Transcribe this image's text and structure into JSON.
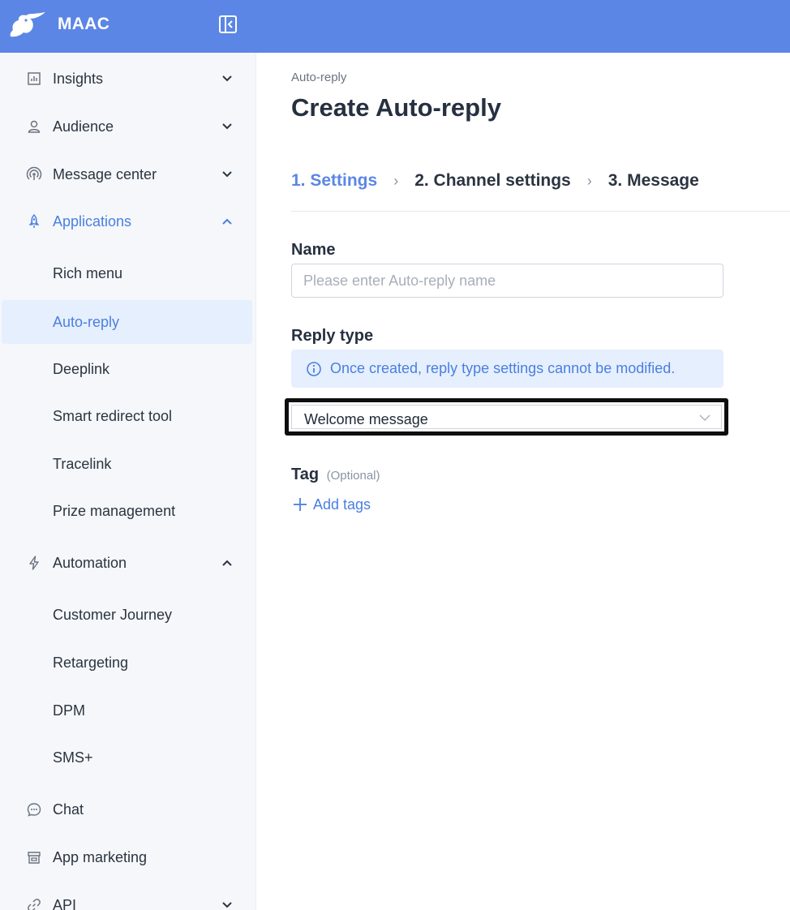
{
  "app": {
    "brand": "MAAC"
  },
  "sidebar": {
    "items": [
      {
        "label": "Insights",
        "icon": "bar-chart-icon",
        "expanded": false
      },
      {
        "label": "Audience",
        "icon": "user-icon",
        "expanded": false
      },
      {
        "label": "Message center",
        "icon": "broadcast-icon",
        "expanded": false
      },
      {
        "label": "Applications",
        "icon": "rocket-icon",
        "expanded": true,
        "children": [
          "Rich menu",
          "Auto-reply",
          "Deeplink",
          "Smart redirect tool",
          "Tracelink",
          "Prize management"
        ]
      },
      {
        "label": "Automation",
        "icon": "lightning-icon",
        "expanded": true,
        "children": [
          "Customer Journey",
          "Retargeting",
          "DPM",
          "SMS+"
        ]
      },
      {
        "label": "Chat",
        "icon": "chat-bubble-icon"
      },
      {
        "label": "App marketing",
        "icon": "store-icon"
      },
      {
        "label": "API",
        "icon": "link-icon",
        "expanded": false
      }
    ],
    "selected": "Auto-reply"
  },
  "main": {
    "breadcrumb": "Auto-reply",
    "title": "Create Auto-reply",
    "steps": [
      "1. Settings",
      "2. Channel settings",
      "3. Message"
    ],
    "current_step": 0,
    "name": {
      "label": "Name",
      "placeholder": "Please enter Auto-reply name",
      "value": ""
    },
    "reply_type": {
      "label": "Reply type",
      "notice": "Once created, reply type settings cannot be modified.",
      "selected": "Welcome message"
    },
    "tag": {
      "label": "Tag",
      "optional": "(Optional)",
      "add_label": "Add tags"
    }
  },
  "colors": {
    "topbar": "#5b86e5",
    "accent": "#4a7fe0",
    "sidebar_bg": "#f5f7fa",
    "selected_bg": "#e6effd"
  }
}
